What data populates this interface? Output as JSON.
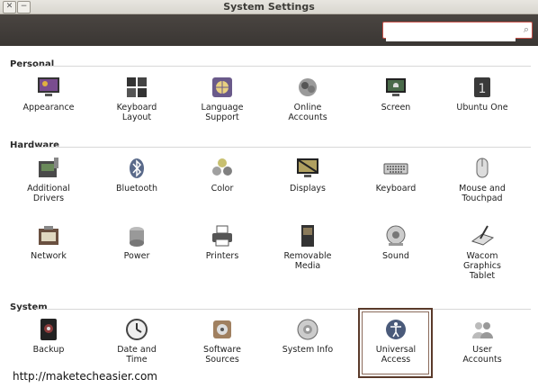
{
  "window": {
    "title": "System Settings"
  },
  "search": {
    "placeholder": ""
  },
  "categories": {
    "personal": "Personal",
    "hardware": "Hardware",
    "system": "System"
  },
  "items": {
    "appearance": "Appearance",
    "keyboard_layout": "Keyboard\nLayout",
    "language_support": "Language\nSupport",
    "online_accounts": "Online\nAccounts",
    "screen": "Screen",
    "ubuntu_one": "Ubuntu One",
    "additional_drivers": "Additional\nDrivers",
    "bluetooth": "Bluetooth",
    "color": "Color",
    "displays": "Displays",
    "keyboard": "Keyboard",
    "mouse_touchpad": "Mouse and\nTouchpad",
    "network": "Network",
    "power": "Power",
    "printers": "Printers",
    "removable_media": "Removable\nMedia",
    "sound": "Sound",
    "wacom": "Wacom\nGraphics\nTablet",
    "backup": "Backup",
    "date_time": "Date and\nTime",
    "software_sources": "Software\nSources",
    "system_info": "System Info",
    "universal_access": "Universal\nAccess",
    "user_accounts": "User\nAccounts"
  },
  "watermark": "http://maketecheasier.com"
}
